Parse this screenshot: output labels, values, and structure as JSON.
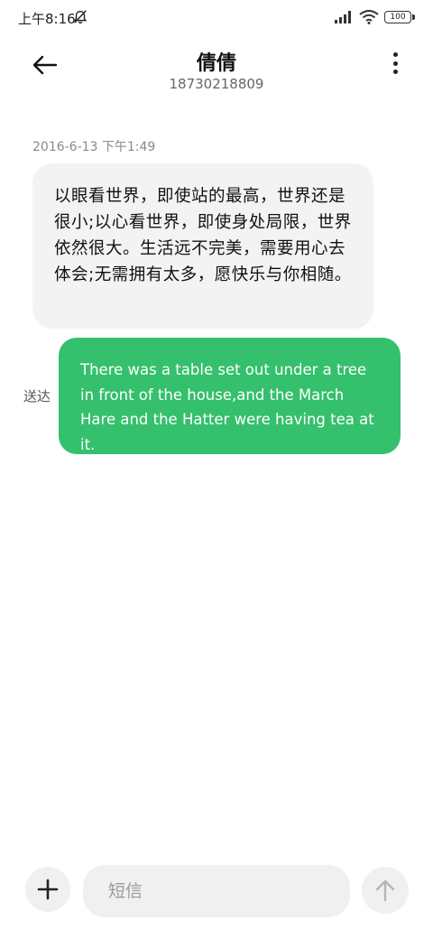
{
  "status_bar": {
    "time": "上午8:16",
    "icons": [
      "mute-notifications-icon",
      "signal-icon",
      "wifi-icon",
      "battery-icon"
    ],
    "battery_level": "100"
  },
  "header": {
    "back_icon": "back-arrow-icon",
    "contact_name": "倩倩",
    "contact_number": "18730218809",
    "more_icon": "more-vertical-icon"
  },
  "conversation": {
    "timestamp": "2016-6-13 下午1:49",
    "received_message": "以眼看世界，即使站的最高，世界还是很小;以心看世界，即使身处局限，世界依然很大。生活远不完美，需要用心去体会;无需拥有太多，愿快乐与你相随。",
    "sent_message": "There was a table set out under a tree in front of the house,and the March Hare and the Hatter were having tea at it.",
    "sent_status": "送达"
  },
  "input_bar": {
    "add_icon": "plus-icon",
    "placeholder": "短信",
    "value": "",
    "send_icon": "send-arrow-up-icon"
  },
  "colors": {
    "sent_bubble": "#34c06c",
    "received_bubble": "#f3f3f3",
    "input_background": "#f0f0f0"
  }
}
